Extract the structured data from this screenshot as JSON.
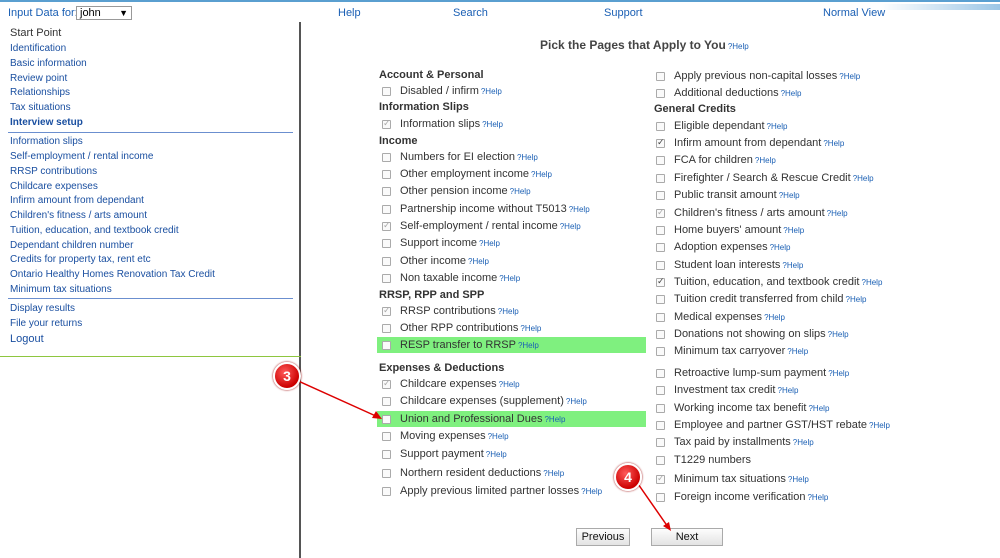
{
  "topbar": {
    "input_label": "Input Data for:",
    "user_value": "john",
    "help": "Help",
    "search": "Search",
    "support": "Support",
    "normal_view": "Normal View"
  },
  "sidebar": {
    "start_point": "Start Point",
    "identification": "Identification",
    "basic_information": "Basic information",
    "review_point": "Review point",
    "relationships": "Relationships",
    "tax_situations": "Tax situations",
    "interview_setup": "Interview setup",
    "information_slips": "Information slips",
    "self_employment": "Self-employment / rental income",
    "rrsp_contributions": "RRSP contributions",
    "childcare_expenses": "Childcare expenses",
    "infirm_amount": "Infirm amount from dependant",
    "childrens_fitness": "Children's fitness / arts amount",
    "tuition": "Tuition, education, and textbook credit",
    "dependant_children": "Dependant children number",
    "credits_property": "Credits for property tax, rent etc",
    "ontario_healthy": "Ontario Healthy Homes Renovation Tax Credit",
    "minimum_tax": "Minimum tax situations",
    "display_results": "Display results",
    "file_returns": "File your returns",
    "logout": "Logout"
  },
  "main": {
    "heading": "Pick the Pages that Apply to You",
    "help_tag": "?Help",
    "sections": {
      "account": "Account & Personal",
      "info_slips": "Information Slips",
      "income": "Income",
      "rrsp": "RRSP, RPP and SPP",
      "expenses": "Expenses & Deductions",
      "general_credits": "General Credits"
    },
    "items": {
      "disabled": "Disabled / infirm",
      "information_slips": "Information slips",
      "numbers_ei": "Numbers for EI election",
      "other_employment": "Other employment income",
      "other_pension": "Other pension income",
      "partnership": "Partnership income without T5013",
      "self_employment": "Self-employment / rental income",
      "support_income": "Support income",
      "other_income": "Other income",
      "non_taxable": "Non taxable income",
      "rrsp_contributions": "RRSP contributions",
      "other_rpp": "Other RPP contributions",
      "resp_transfer": "RESP transfer to RRSP",
      "childcare": "Childcare expenses",
      "childcare_supp": "Childcare expenses (supplement)",
      "union_dues": "Union and Professional Dues",
      "moving": "Moving expenses",
      "support_payment": "Support payment",
      "northern": "Northern resident deductions",
      "limited_partner": "Apply previous limited partner losses",
      "non_capital": "Apply previous non-capital losses",
      "additional": "Additional deductions",
      "eligible_dependant": "Eligible dependant",
      "infirm_amount": "Infirm amount from dependant",
      "fca_children": "FCA for children",
      "firefighter": "Firefighter / Search & Rescue Credit",
      "public_transit": "Public transit amount",
      "childrens_fitness": "Children's fitness / arts amount",
      "home_buyers": "Home buyers' amount",
      "adoption": "Adoption expenses",
      "student_loan": "Student loan interests",
      "tuition": "Tuition, education, and textbook credit",
      "tuition_transferred": "Tuition credit transferred from child",
      "medical": "Medical expenses",
      "donations": "Donations not showing on slips",
      "min_tax_carryover": "Minimum tax carryover",
      "retroactive": "Retroactive lump-sum payment",
      "investment": "Investment tax credit",
      "working_income": "Working income tax benefit",
      "gst_rebate": "Employee and partner GST/HST rebate",
      "tax_installments": "Tax paid by installments",
      "t1229": "T1229 numbers",
      "min_tax_situations": "Minimum tax situations",
      "foreign_income": "Foreign income verification"
    },
    "previous": "Previous",
    "next": "Next"
  },
  "markers": {
    "m3": "3",
    "m4": "4"
  },
  "colors": {
    "link": "#1a4fa0",
    "highlight": "#7ff07f",
    "marker": "#cc0000"
  }
}
